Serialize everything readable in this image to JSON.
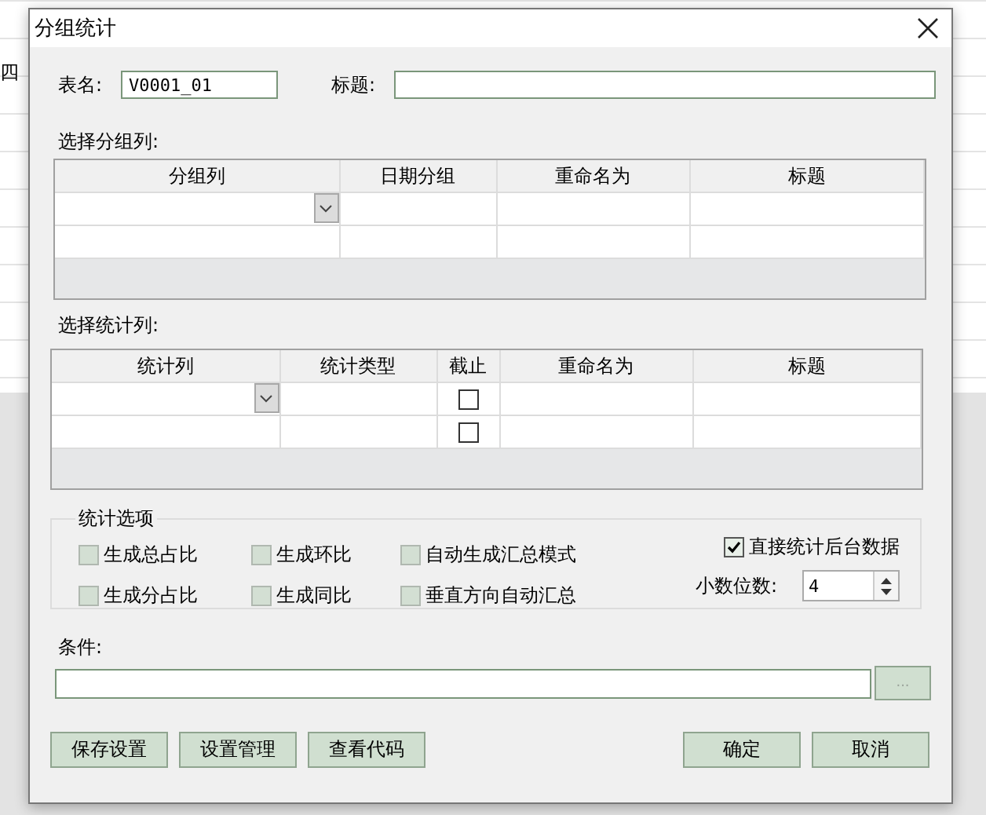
{
  "background": {
    "cell": "四"
  },
  "window": {
    "title": "分组统计"
  },
  "table_name": {
    "label": "表名:",
    "value": "V0001_01"
  },
  "title_field": {
    "label": "标题:"
  },
  "group_section": {
    "label": "选择分组列:",
    "columns": [
      "分组列",
      "日期分组",
      "重命名为",
      "标题"
    ],
    "rows": [
      {
        "dropdown": true
      },
      {
        "dropdown": false
      }
    ]
  },
  "stat_section": {
    "label": "选择统计列:",
    "columns": [
      "统计列",
      "统计类型",
      "截止",
      "重命名为",
      "标题"
    ],
    "rows": [
      {
        "dropdown": true,
        "cutoff_checked": false
      },
      {
        "dropdown": false,
        "cutoff_checked": false
      }
    ]
  },
  "options": {
    "title": "统计选项",
    "checkboxes": [
      {
        "label": "生成总占比",
        "checked": false
      },
      {
        "label": "生成环比",
        "checked": false
      },
      {
        "label": "自动生成汇总模式",
        "checked": false
      },
      {
        "label": "生成分占比",
        "checked": false
      },
      {
        "label": "生成同比",
        "checked": false
      },
      {
        "label": "垂直方向自动汇总",
        "checked": false
      }
    ],
    "direct": {
      "label": "直接统计后台数据",
      "checked": true
    },
    "decimals": {
      "label": "小数位数:",
      "value": "4"
    }
  },
  "condition": {
    "label": "条件:",
    "browse_button": {
      "label": "...",
      "disabled": true
    }
  },
  "buttons_left": [
    "保存设置",
    "设置管理",
    "查看代码"
  ],
  "buttons_right": [
    "确定",
    "取消"
  ]
}
